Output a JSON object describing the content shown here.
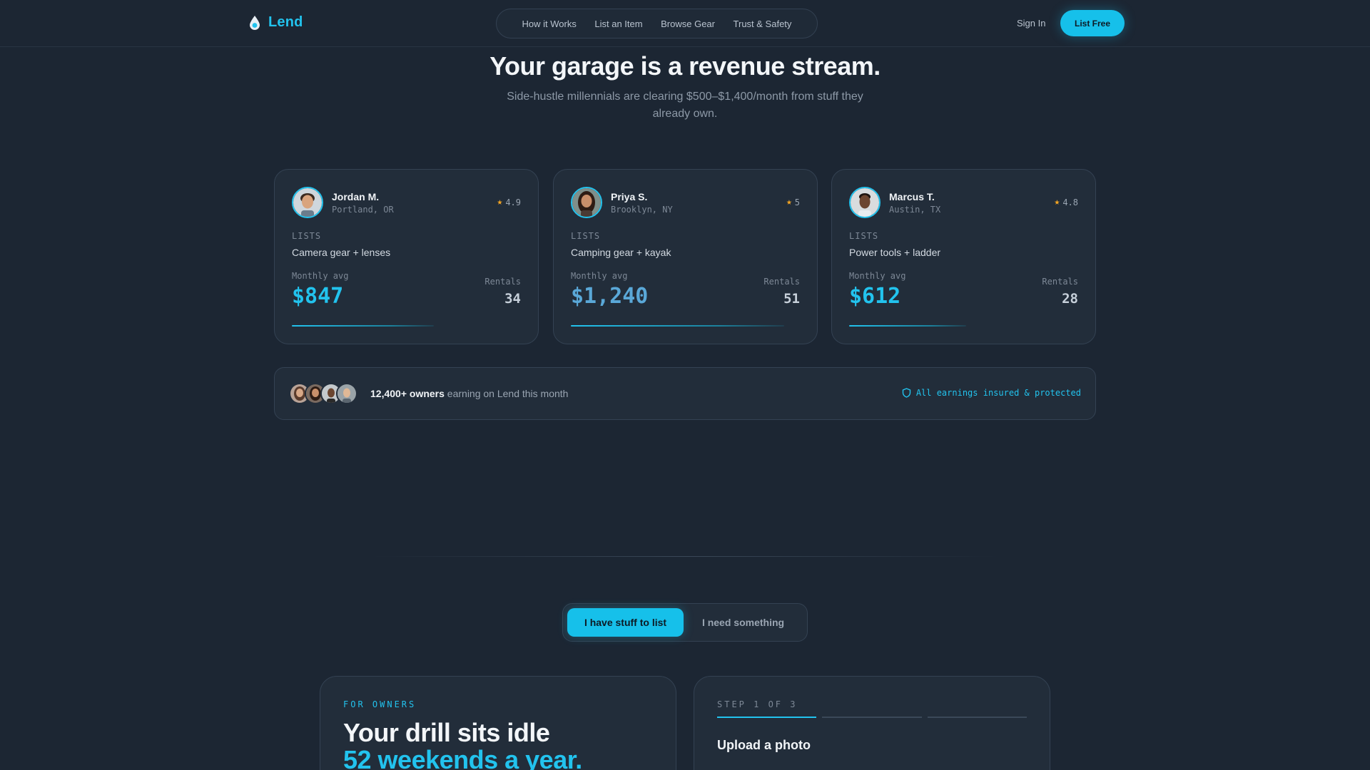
{
  "nav": {
    "brand": "Lend",
    "links": [
      "How it Works",
      "List an Item",
      "Browse Gear",
      "Trust & Safety"
    ],
    "sign_in": "Sign In",
    "cta": "List Free"
  },
  "hero": {
    "title": "Your garage is a revenue stream.",
    "subtitle": "Side-hustle millennials are clearing $500–$1,400/month from stuff they already own."
  },
  "earners": [
    {
      "name": "Jordan M.",
      "location": "Portland, OR",
      "rating": "4.9",
      "lists_label": "LISTS",
      "lists": "Camera gear + lenses",
      "monthly_label": "Monthly avg",
      "monthly": "$847",
      "rentals_label": "Rentals",
      "rentals": "34",
      "progress": 0.62
    },
    {
      "name": "Priya S.",
      "location": "Brooklyn, NY",
      "rating": "5",
      "lists_label": "LISTS",
      "lists": "Camping gear + kayak",
      "monthly_label": "Monthly avg",
      "monthly": "$1,240",
      "rentals_label": "Rentals",
      "rentals": "51",
      "progress": 0.93
    },
    {
      "name": "Marcus T.",
      "location": "Austin, TX",
      "rating": "4.8",
      "lists_label": "LISTS",
      "lists": "Power tools + ladder",
      "monthly_label": "Monthly avg",
      "monthly": "$612",
      "rentals_label": "Rentals",
      "rentals": "28",
      "progress": 0.51
    }
  ],
  "social_proof": {
    "count": "12,400+ owners",
    "text": " earning on Lend this month",
    "insured": "All earnings insured & protected"
  },
  "toggle": {
    "active": "I have stuff to list",
    "inactive": "I need something"
  },
  "owners_panel": {
    "eyebrow": "FOR OWNERS",
    "title_line1": "Your drill sits idle",
    "title_line2": "52 weekends a year."
  },
  "steps_panel": {
    "label": "STEP 1 OF 3",
    "current_step": 1,
    "total_steps": 3,
    "title": "Upload a photo"
  },
  "colors": {
    "background": "#1c2633",
    "card": "#222d3a",
    "accent": "#16c0ea",
    "star": "#f5a623"
  }
}
